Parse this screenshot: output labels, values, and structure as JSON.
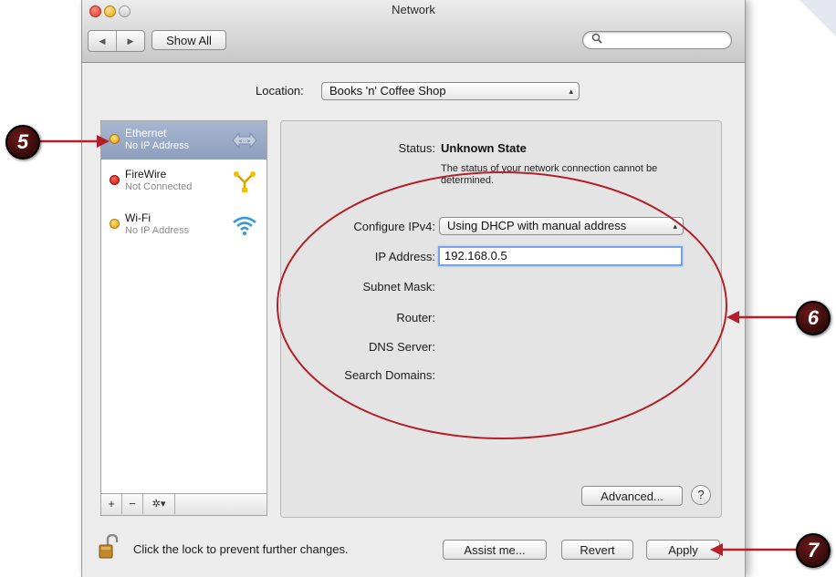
{
  "window": {
    "title": "Network"
  },
  "toolbar": {
    "back": "◀",
    "forward": "▶",
    "show_all": "Show All",
    "search_placeholder": ""
  },
  "location": {
    "label": "Location:",
    "value": "Books 'n' Coffee Shop"
  },
  "services": [
    {
      "name": "Ethernet",
      "status": "No IP Address",
      "dot": "yellow",
      "icon": "ethernet-arrows-icon",
      "selected": true
    },
    {
      "name": "FireWire",
      "status": "Not Connected",
      "dot": "red",
      "icon": "firewire-icon",
      "selected": false
    },
    {
      "name": "Wi-Fi",
      "status": "No IP Address",
      "dot": "yellow",
      "icon": "wifi-icon",
      "selected": false
    }
  ],
  "list_toolbar": {
    "add": "+",
    "remove": "−",
    "action": "✲▾"
  },
  "detail": {
    "status_label": "Status:",
    "status_value": "Unknown State",
    "status_description": "The status of your network connection cannot be determined.",
    "configure_label": "Configure IPv4:",
    "configure_value": "Using DHCP with manual address",
    "ip_label": "IP Address:",
    "ip_value": "192.168.0.5",
    "subnet_label": "Subnet Mask:",
    "router_label": "Router:",
    "dns_label": "DNS Server:",
    "search_label": "Search Domains:",
    "advanced": "Advanced...",
    "help": "?"
  },
  "footer": {
    "lock_text": "Click the lock to prevent further changes.",
    "assist": "Assist me...",
    "revert": "Revert",
    "apply": "Apply"
  },
  "callouts": {
    "c5": "5",
    "c6": "6",
    "c7": "7",
    "color": "#b3202a"
  },
  "colors": {
    "selection": "#97a8c6",
    "focus_ring": "#76a4e6"
  }
}
